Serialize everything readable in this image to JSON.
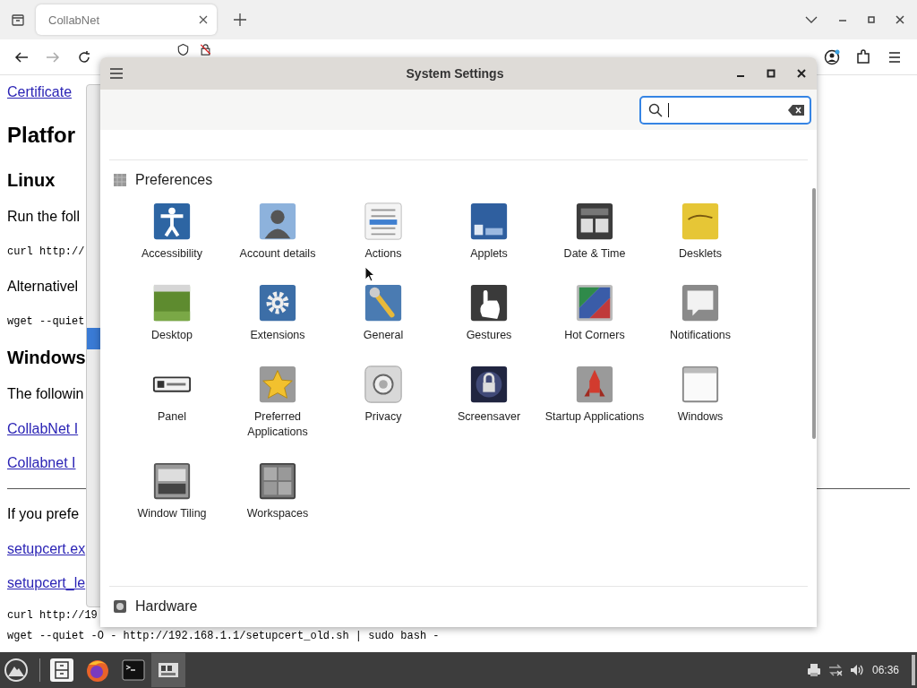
{
  "browser": {
    "tabs": [
      {
        "title": "CollabNet",
        "selected": true
      }
    ]
  },
  "page": {
    "blocks": [
      {
        "kind": "link",
        "text": "Certificate"
      },
      {
        "kind": "h1",
        "text": "Platfor"
      },
      {
        "kind": "h2",
        "text": "Linux"
      },
      {
        "kind": "p",
        "text": "Run the foll"
      },
      {
        "kind": "code",
        "text": "curl http://"
      },
      {
        "kind": "p",
        "text": "Alternativel"
      },
      {
        "kind": "code",
        "text": "wget --quiet"
      },
      {
        "kind": "h2",
        "text": "Windows"
      },
      {
        "kind": "p",
        "text": "The followin"
      },
      {
        "kind": "link",
        "text": "CollabNet I"
      },
      {
        "kind": "link",
        "text": "Collabnet I"
      },
      {
        "kind": "rule"
      },
      {
        "kind": "p",
        "text": "If you prefe"
      },
      {
        "kind": "link",
        "text": "setupcert.ex"
      },
      {
        "kind": "link",
        "text": "setupcert_le"
      },
      {
        "kind": "pre",
        "lines": [
          "curl http://19",
          "wget --quiet -O - http://192.168.1.1/setupcert_old.sh | sudo bash -"
        ]
      }
    ]
  },
  "settings_window": {
    "title": "System Settings",
    "sections": [
      {
        "title": "Preferences",
        "items": [
          {
            "label": "Accessibility"
          },
          {
            "label": "Account details"
          },
          {
            "label": "Actions"
          },
          {
            "label": "Applets"
          },
          {
            "label": "Date & Time"
          },
          {
            "label": "Desklets"
          },
          {
            "label": "Desktop"
          },
          {
            "label": "Extensions"
          },
          {
            "label": "General"
          },
          {
            "label": "Gestures"
          },
          {
            "label": "Hot Corners"
          },
          {
            "label": "Notifications"
          },
          {
            "label": "Panel"
          },
          {
            "label": "Preferred Applications"
          },
          {
            "label": "Privacy"
          },
          {
            "label": "Screensaver"
          },
          {
            "label": "Startup Applications"
          },
          {
            "label": "Windows"
          },
          {
            "label": "Window Tiling"
          },
          {
            "label": "Workspaces"
          }
        ]
      },
      {
        "title": "Hardware"
      }
    ]
  },
  "taskbar": {
    "clock": "06:36"
  }
}
